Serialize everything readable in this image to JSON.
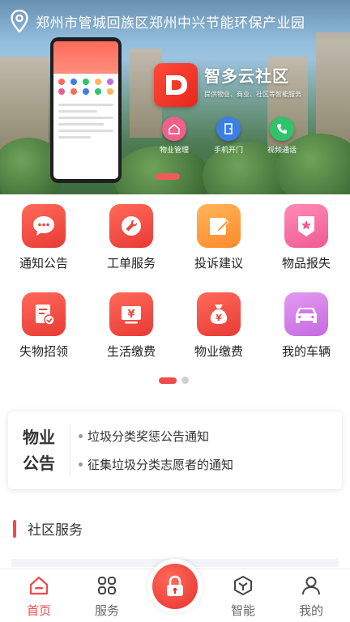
{
  "location": {
    "text": "郑州市管城回族区郑州中兴节能环保产业园",
    "icon": "location-pin-icon"
  },
  "banner": {
    "brand_name": "智多云社区",
    "brand_sub": "提供物业、商业、社区等智能服务",
    "features": [
      {
        "label": "物业管理",
        "icon": "home-icon",
        "color": "#f0608a"
      },
      {
        "label": "手机开门",
        "icon": "door-icon",
        "color": "#3a7ee6"
      },
      {
        "label": "视频通话",
        "icon": "phone-icon",
        "color": "#2fc46a"
      }
    ]
  },
  "services": [
    {
      "label": "通知公告",
      "icon": "chat-bubble-icon"
    },
    {
      "label": "工单服务",
      "icon": "wrench-icon"
    },
    {
      "label": "投诉建议",
      "icon": "edit-note-icon"
    },
    {
      "label": "物品报失",
      "icon": "star-badge-icon"
    },
    {
      "label": "失物招领",
      "icon": "document-check-icon"
    },
    {
      "label": "生活缴费",
      "icon": "yen-card-icon"
    },
    {
      "label": "物业缴费",
      "icon": "money-bag-icon"
    },
    {
      "label": "我的车辆",
      "icon": "car-icon"
    }
  ],
  "notice": {
    "title_line1": "物业",
    "title_line2": "公告",
    "items": [
      "垃圾分类奖惩公告通知",
      "征集垃圾分类志愿者的通知"
    ]
  },
  "section": {
    "title": "社区服务"
  },
  "tabbar": {
    "home": "首页",
    "service": "服务",
    "smart": "智能",
    "mine": "我的",
    "active_color": "#f24a4a"
  }
}
